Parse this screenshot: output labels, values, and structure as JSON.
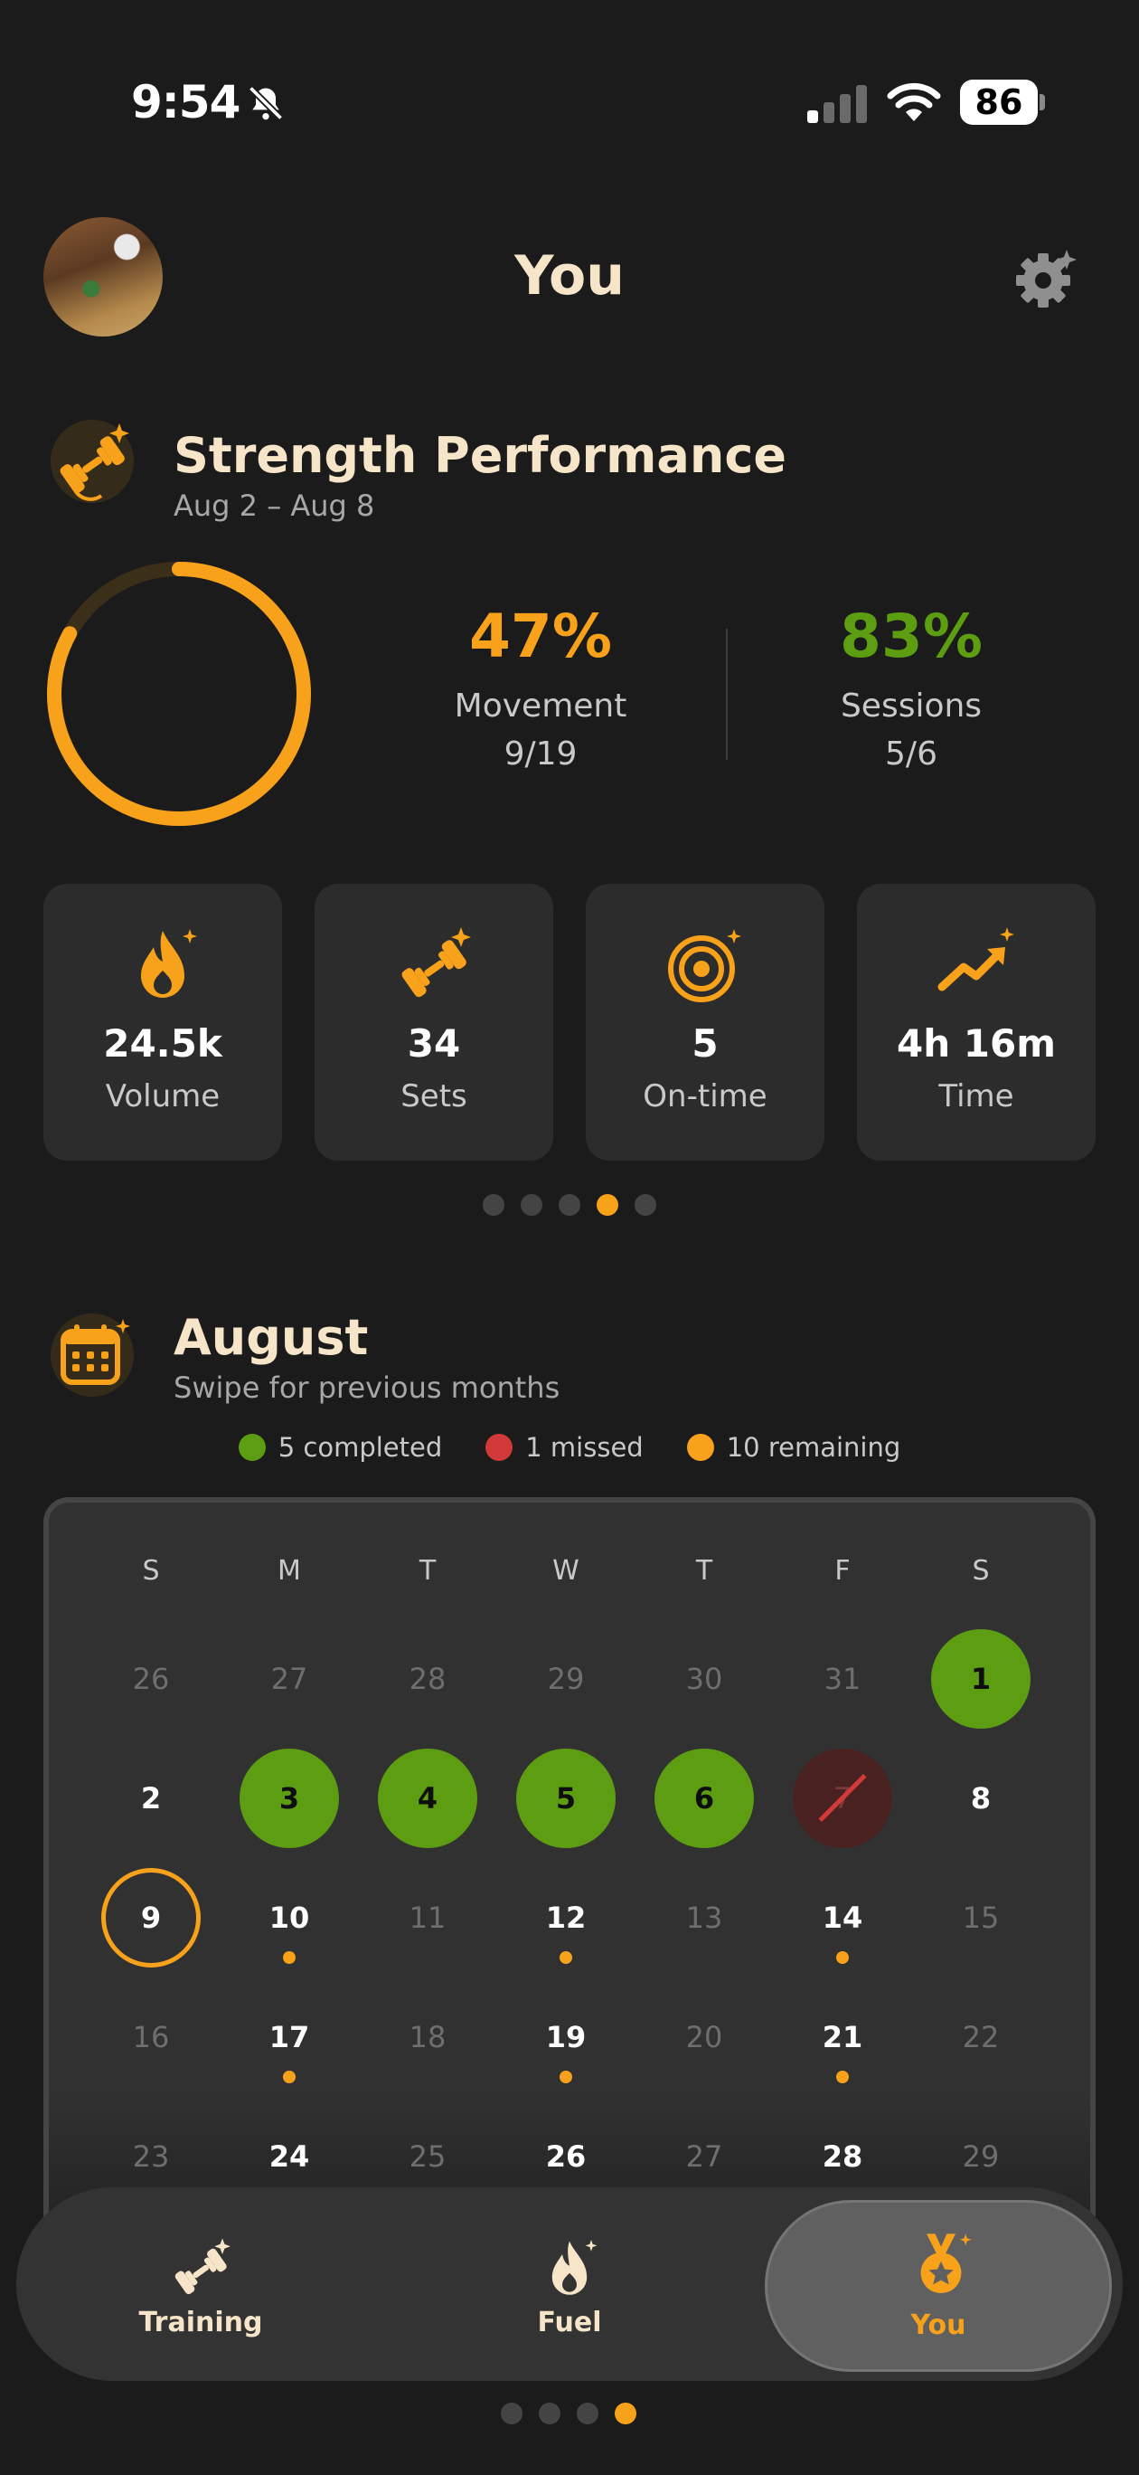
{
  "status_bar": {
    "time": "9:54",
    "battery": "86"
  },
  "header": {
    "title": "You"
  },
  "strength": {
    "title": "Strength Performance",
    "date_range": "Aug 2 – Aug 8",
    "ring_progress": 0.83,
    "movement": {
      "percent": "47%",
      "label": "Movement",
      "fraction": "9/19"
    },
    "sessions": {
      "percent": "83%",
      "label": "Sessions",
      "fraction": "5/6"
    }
  },
  "stats": [
    {
      "icon": "flame-icon",
      "value": "24.5k",
      "label": "Volume"
    },
    {
      "icon": "dumbbell-icon",
      "value": "34",
      "label": "Sets"
    },
    {
      "icon": "target-icon",
      "value": "5",
      "label": "On-time"
    },
    {
      "icon": "trend-up-icon",
      "value": "4h 16m",
      "label": "Time"
    }
  ],
  "stats_pager": {
    "count": 5,
    "active": 3
  },
  "calendar_section": {
    "title": "August",
    "subtitle": "Swipe for previous months",
    "legend": {
      "completed": "5 completed",
      "missed": "1 missed",
      "remaining": "10 remaining"
    },
    "weekdays": [
      "S",
      "M",
      "T",
      "W",
      "T",
      "F",
      "S"
    ],
    "weeks": [
      [
        {
          "d": "26",
          "s": "dim"
        },
        {
          "d": "27",
          "s": "dim"
        },
        {
          "d": "28",
          "s": "dim"
        },
        {
          "d": "29",
          "s": "dim"
        },
        {
          "d": "30",
          "s": "dim"
        },
        {
          "d": "31",
          "s": "dim"
        },
        {
          "d": "1",
          "s": "done"
        }
      ],
      [
        {
          "d": "2",
          "s": "normal"
        },
        {
          "d": "3",
          "s": "done"
        },
        {
          "d": "4",
          "s": "done"
        },
        {
          "d": "5",
          "s": "done"
        },
        {
          "d": "6",
          "s": "done"
        },
        {
          "d": "7",
          "s": "missed"
        },
        {
          "d": "8",
          "s": "normal"
        }
      ],
      [
        {
          "d": "9",
          "s": "today"
        },
        {
          "d": "10",
          "s": "pending"
        },
        {
          "d": "11",
          "s": "dim"
        },
        {
          "d": "12",
          "s": "pending"
        },
        {
          "d": "13",
          "s": "dim"
        },
        {
          "d": "14",
          "s": "pending"
        },
        {
          "d": "15",
          "s": "dim"
        }
      ],
      [
        {
          "d": "16",
          "s": "dim"
        },
        {
          "d": "17",
          "s": "pending"
        },
        {
          "d": "18",
          "s": "dim"
        },
        {
          "d": "19",
          "s": "pending"
        },
        {
          "d": "20",
          "s": "dim"
        },
        {
          "d": "21",
          "s": "pending"
        },
        {
          "d": "22",
          "s": "dim"
        }
      ],
      [
        {
          "d": "23",
          "s": "dim"
        },
        {
          "d": "24",
          "s": "pending"
        },
        {
          "d": "25",
          "s": "dim"
        },
        {
          "d": "26",
          "s": "pending"
        },
        {
          "d": "27",
          "s": "dim"
        },
        {
          "d": "28",
          "s": "pending"
        },
        {
          "d": "29",
          "s": "dim"
        }
      ]
    ]
  },
  "tabs": [
    {
      "label": "Training",
      "icon": "dumbbell-icon"
    },
    {
      "label": "Fuel",
      "icon": "flame-icon"
    },
    {
      "label": "You",
      "icon": "medal-icon"
    }
  ],
  "page_pager": {
    "count": 4,
    "active": 3
  },
  "colors": {
    "accent": "#f7a21a",
    "success": "#5c9d12",
    "missed": "#d23a3a",
    "background": "#1b1b1b",
    "card": "#2c2c2c"
  }
}
